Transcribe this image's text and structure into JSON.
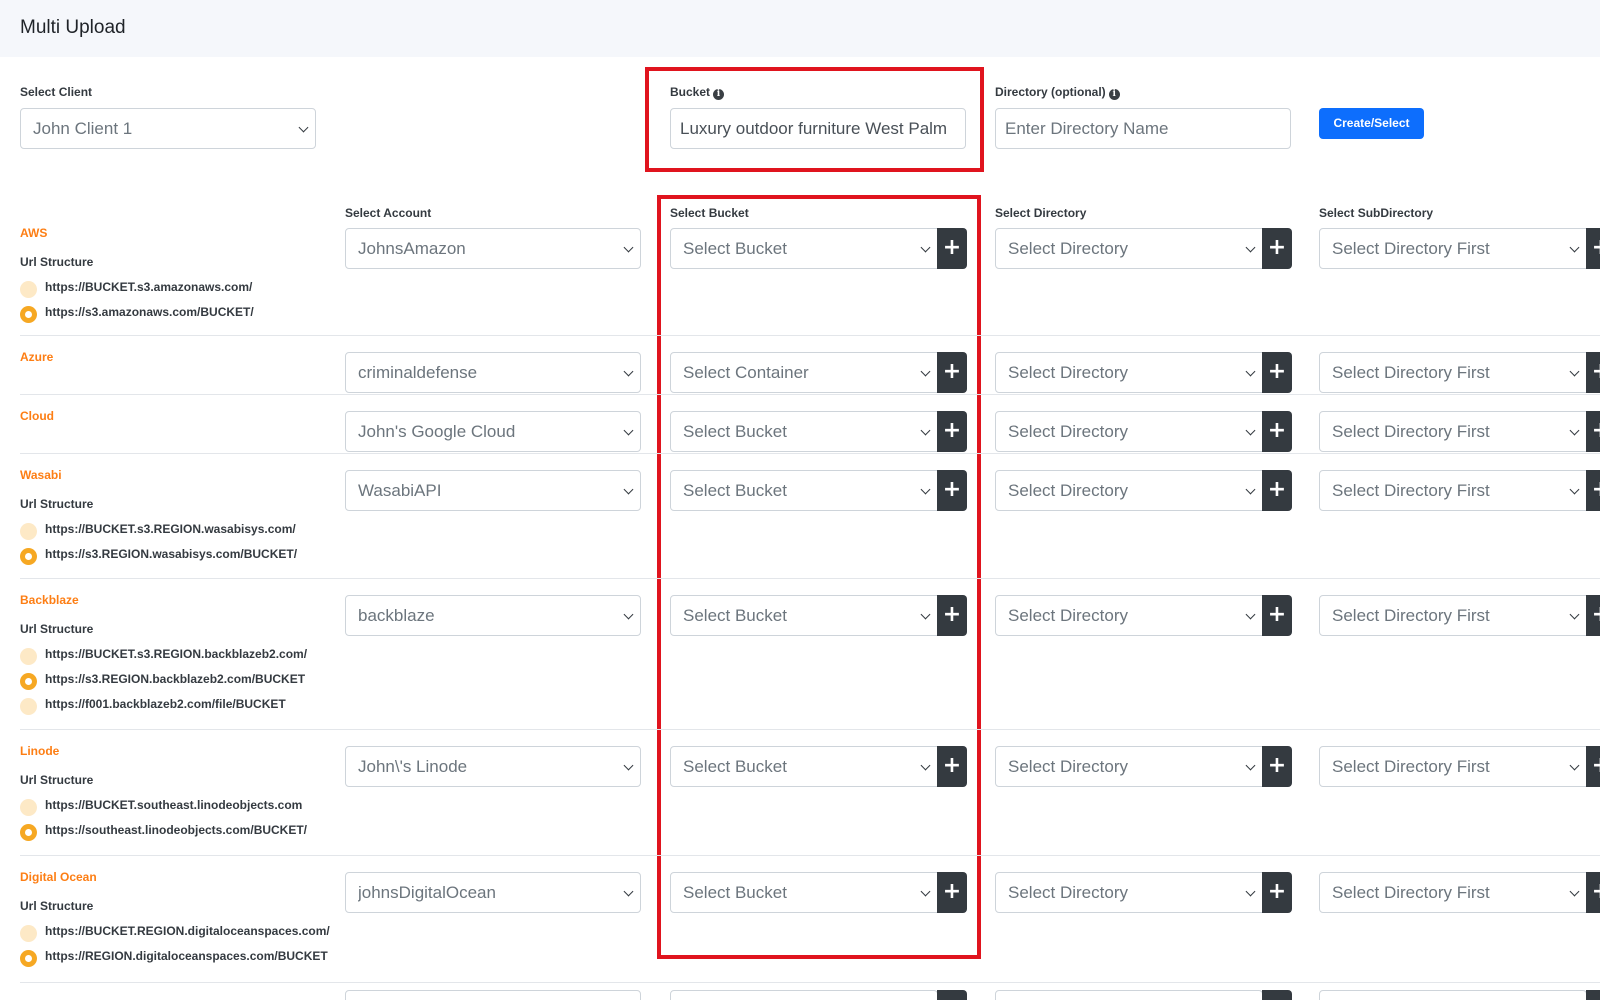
{
  "header": {
    "title": "Multi Upload"
  },
  "form": {
    "client_label": "Select Client",
    "client_value": "John Client 1",
    "bucket_label": "Bucket",
    "bucket_value": "Luxury outdoor furniture West Palm",
    "directory_label": "Directory (optional)",
    "directory_placeholder": "Enter Directory Name",
    "create_button": "Create/Select"
  },
  "columns": {
    "account": "Select Account",
    "bucket": "Select Bucket",
    "directory": "Select Directory",
    "subdirectory": "Select SubDirectory"
  },
  "url_structure_label": "Url Structure",
  "providers": [
    {
      "name": "AWS",
      "account": "JohnsAmazon",
      "bucket": "Select Bucket",
      "directory": "Select Directory",
      "subdirectory": "Select Directory First",
      "urls": [
        "https://BUCKET.s3.amazonaws.com/",
        "https://s3.amazonaws.com/BUCKET/"
      ],
      "selected_url": 1
    },
    {
      "name": "Azure",
      "account": "criminaldefense",
      "bucket": "Select Container",
      "directory": "Select Directory",
      "subdirectory": "Select Directory First",
      "urls": [],
      "selected_url": null
    },
    {
      "name": "Cloud",
      "account": "John's Google Cloud",
      "bucket": "Select Bucket",
      "directory": "Select Directory",
      "subdirectory": "Select Directory First",
      "urls": [],
      "selected_url": null
    },
    {
      "name": "Wasabi",
      "account": "WasabiAPI",
      "bucket": "Select Bucket",
      "directory": "Select Directory",
      "subdirectory": "Select Directory First",
      "urls": [
        "https://BUCKET.s3.REGION.wasabisys.com/",
        "https://s3.REGION.wasabisys.com/BUCKET/"
      ],
      "selected_url": 1
    },
    {
      "name": "Backblaze",
      "account": "backblaze",
      "bucket": "Select Bucket",
      "directory": "Select Directory",
      "subdirectory": "Select Directory First",
      "urls": [
        "https://BUCKET.s3.REGION.backblazeb2.com/",
        "https://s3.REGION.backblazeb2.com/BUCKET",
        "https://f001.backblazeb2.com/file/BUCKET"
      ],
      "selected_url": 1
    },
    {
      "name": "Linode",
      "account": "John\\'s Linode",
      "bucket": "Select Bucket",
      "directory": "Select Directory",
      "subdirectory": "Select Directory First",
      "urls": [
        "https://BUCKET.southeast.linodeobjects.com",
        "https://southeast.linodeobjects.com/BUCKET/"
      ],
      "selected_url": 1
    },
    {
      "name": "Digital Ocean",
      "account": "johnsDigitalOcean",
      "bucket": "Select Bucket",
      "directory": "Select Directory",
      "subdirectory": "Select Directory First",
      "urls": [
        "https://BUCKET.REGION.digitaloceanspaces.com/",
        "https://REGION.digitaloceanspaces.com/BUCKET"
      ],
      "selected_url": 1
    }
  ],
  "icons": {
    "add": "+",
    "info": "i"
  },
  "colors": {
    "highlight": "#e0141e",
    "provider": "#fd7e14",
    "primary": "#0d6efd",
    "add_button": "#343a40",
    "radio_selected": "#f6a823"
  }
}
